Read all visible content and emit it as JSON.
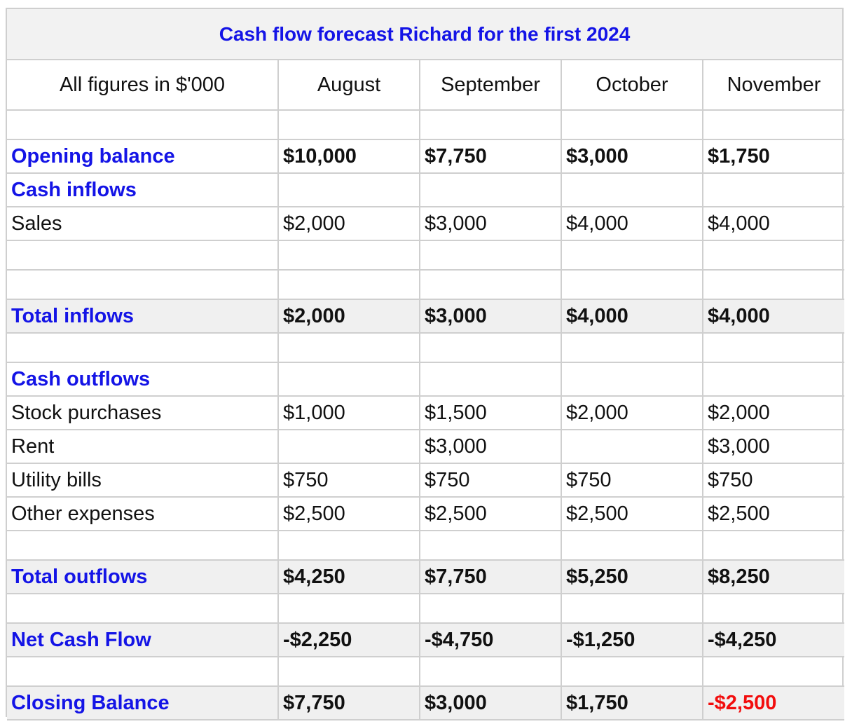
{
  "title": "Cash flow forecast Richard for the first 2024",
  "header": {
    "units_label": "All figures in $'000",
    "months": [
      "August",
      "September",
      "October",
      "November"
    ]
  },
  "rows": {
    "opening_balance": {
      "label": "Opening balance",
      "values": [
        "$10,000",
        "$7,750",
        "$3,000",
        "$1,750"
      ]
    },
    "cash_inflows": {
      "label": "Cash inflows"
    },
    "sales": {
      "label": "Sales",
      "values": [
        "$2,000",
        "$3,000",
        "$4,000",
        "$4,000"
      ]
    },
    "total_inflows": {
      "label": "Total inflows",
      "values": [
        "$2,000",
        "$3,000",
        "$4,000",
        "$4,000"
      ]
    },
    "cash_outflows": {
      "label": "Cash outflows"
    },
    "stock_purchases": {
      "label": "Stock purchases",
      "values": [
        "$1,000",
        "$1,500",
        "$2,000",
        "$2,000"
      ]
    },
    "rent": {
      "label": "Rent",
      "values": [
        "",
        "$3,000",
        "",
        "$3,000"
      ]
    },
    "utility_bills": {
      "label": "Utility bills",
      "values": [
        "$750",
        "$750",
        "$750",
        "$750"
      ]
    },
    "other_expenses": {
      "label": "Other expenses",
      "values": [
        "$2,500",
        "$2,500",
        "$2,500",
        "$2,500"
      ]
    },
    "total_outflows": {
      "label": "Total outflows",
      "values": [
        "$4,250",
        "$7,750",
        "$5,250",
        "$8,250"
      ]
    },
    "net_cash_flow": {
      "label": "Net Cash Flow",
      "values": [
        "-$2,250",
        "-$4,750",
        "-$1,250",
        "-$4,250"
      ]
    },
    "closing_balance": {
      "label": "Closing Balance",
      "values": [
        "$7,750",
        "$3,000",
        "$1,750",
        "-$2,500"
      ]
    }
  },
  "colors": {
    "label_blue": "#1414e6",
    "negative_red": "#f20d0d",
    "shade_gray": "#f0f0f0",
    "border_gray": "#cfcfcf"
  }
}
